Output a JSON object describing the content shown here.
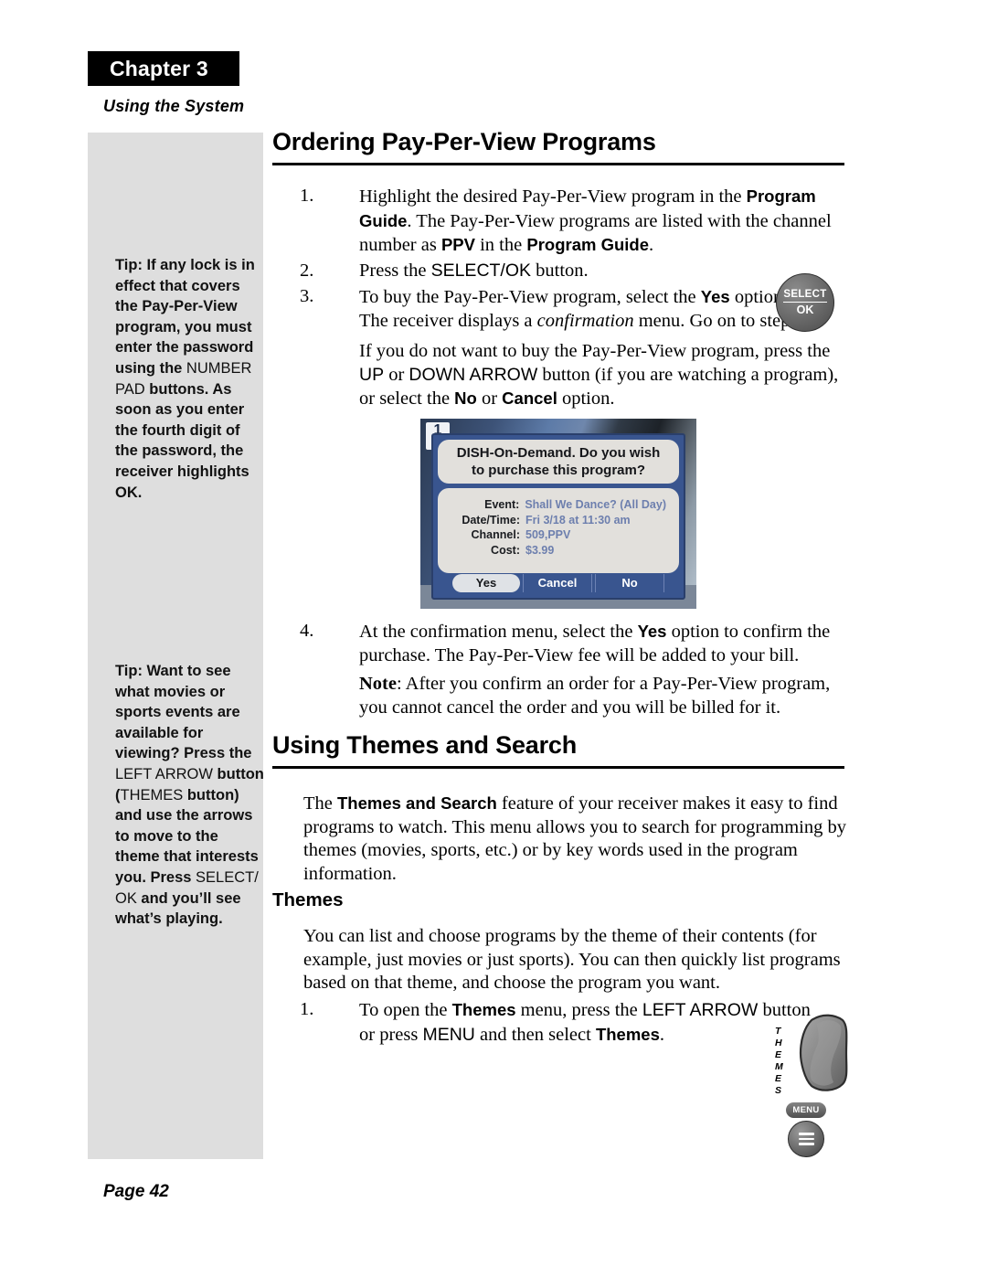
{
  "chapter": {
    "banner": "Chapter 3",
    "subtitle": "Using the System"
  },
  "sidebar": {
    "tips": [
      {
        "parts": [
          {
            "text": "Tip: If any lock is in effect that covers the Pay-Per-View program, you must enter the password using the ",
            "weight": "bold"
          },
          {
            "text": "NUMBER PAD",
            "weight": "light"
          },
          {
            "text": " buttons. As soon as you enter the fourth digit of the password, the receiver highlights OK.",
            "weight": "bold"
          }
        ]
      },
      {
        "parts": [
          {
            "text": "Tip: Want to see what movies or sports events are available for viewing? Press the ",
            "weight": "bold"
          },
          {
            "text": "LEFT ARROW",
            "weight": "light"
          },
          {
            "text": " button (",
            "weight": "bold"
          },
          {
            "text": "THEMES",
            "weight": "light"
          },
          {
            "text": " button) and use the arrows to move to the theme that interests you. Press ",
            "weight": "bold"
          },
          {
            "text": "SELECT/ OK",
            "weight": "light"
          },
          {
            "text": " and you’ll see what’s playing.",
            "weight": "bold"
          }
        ]
      }
    ]
  },
  "sections": {
    "ordering_title": "Ordering Pay-Per-View Programs",
    "themes_title": "Using Themes and Search",
    "themes_subtitle": "Themes"
  },
  "steps": {
    "s1": {
      "number": "1.",
      "a": "Highlight the desired Pay-Per-View program in the ",
      "b1": "Program Guide",
      "c": ". The Pay-Per-View programs are listed with the channel number as ",
      "b2": "PPV",
      "d": " in the ",
      "b3": "Program Guide",
      "e": "."
    },
    "s2": {
      "number": "2.",
      "a": "Press the ",
      "sans": "SELECT/OK",
      "b": " button."
    },
    "s3": {
      "number": "3.",
      "a": "To buy the Pay-Per-View program, select the ",
      "b1": "Yes",
      "c": " option. The receiver displays a ",
      "it": "confirmation",
      "d": " menu. Go on to step 4."
    },
    "s3b": {
      "a": "If you do not want to buy the Pay-Per-View program, press the ",
      "sans1": "UP",
      "b": " or ",
      "sans2": "DOWN ARROW",
      "c": " button (if you are watching a program), or select the ",
      "b1": "No",
      "d": " or ",
      "b2": "Cancel",
      "e": " option."
    },
    "s4": {
      "number": "4.",
      "a": "At the confirmation menu, select the ",
      "b1": "Yes",
      "c": " option to confirm the purchase. The Pay-Per-View fee will be added to your bill."
    },
    "s4note": {
      "label": "Note",
      "text": ": After you confirm an order for a Pay-Per-View program, you cannot cancel the order and you will be billed for it."
    },
    "t1": {
      "a": "The ",
      "b1": "Themes and Search",
      "c": " feature of your receiver makes it easy to find programs to watch. This menu allows you to search for programming by themes (movies, sports, etc.) or by key words used in the program information."
    },
    "t2": {
      "a": "You can list and choose programs by the theme of their contents (for example, just movies or just sports). You can then quickly list programs based on that theme, and choose the program you want."
    },
    "t3": {
      "number": "1.",
      "a": "To open the ",
      "b1": "Themes",
      "c": " menu, press the ",
      "sans1": "LEFT ARROW",
      "d": " button or press ",
      "sans2": "MENU",
      "e": " and then select ",
      "b2": "Themes",
      "f": "."
    }
  },
  "remote": {
    "select_ok": {
      "top": "SELECT",
      "bottom": "OK"
    },
    "themes_label": "THEMES",
    "menu_label": "MENU"
  },
  "tv_screen": {
    "channel_number": "1",
    "headline_line1": "DISH-On-Demand.  Do you wish",
    "headline_line2": "to purchase this program?",
    "rows": [
      {
        "key": "Event:",
        "value": "Shall We Dance? (All Day)"
      },
      {
        "key": "Date/Time:",
        "value": "Fri 3/18 at 11:30 am"
      },
      {
        "key": "Channel:",
        "value": "509,PPV"
      },
      {
        "key": "Cost:",
        "value": "$3.99"
      }
    ],
    "buttons": [
      {
        "label": "Yes",
        "selected": true
      },
      {
        "label": "Cancel",
        "selected": false
      },
      {
        "label": "No",
        "selected": false
      }
    ]
  },
  "footer": {
    "page": "Page 42"
  }
}
